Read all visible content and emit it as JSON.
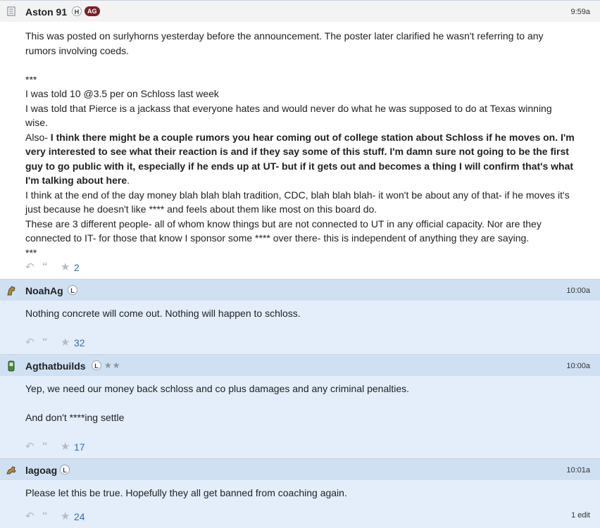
{
  "posts": [
    {
      "username": "Aston 91",
      "avatar_icon": "document-icon",
      "badges": [
        "H",
        "AG"
      ],
      "stars": "",
      "time": "9:59a",
      "lines": [
        "This was posted on surlyhorns yesterday before the announcement. The poster later clarified he wasn't referring to any",
        "rumors involving coeds.",
        "***",
        "I was told 10 @3.5 per on Schloss last week",
        "I was told that Pierce is a jackass that everyone hates and would never do what he was supposed to do at Texas winning wise.",
        "Also- ",
        "I think there might be a couple rumors you hear coming out of college station about Schloss if he moves on. I'm very interested to see what their reaction is and if they say some of this stuff. I'm damn sure not going to be the first guy to go public with it, especially if he ends up at UT- but if it gets out and becomes a thing I will confirm that's what I'm talking about here",
        ".",
        "I think at the end of the day money blah blah blah tradition, CDC, blah blah blah- it won't be about any of that- if he moves it's just because he doesn't like **** and feels about them like most on this board do.",
        "These are 3 different people- all of whom know things but are not connected to UT in any official capacity. Nor are they connected to IT- for those that know I sponsor some **** over there- this is independent of anything they are saying.",
        "***"
      ],
      "star_count": "2",
      "edit": ""
    },
    {
      "username": "NoahAg",
      "avatar_icon": "horse-head-icon",
      "badges": [
        "L"
      ],
      "stars": "",
      "time": "10:00a",
      "text1": "Nothing concrete will come out. Nothing will happen to schloss.",
      "star_count": "32",
      "edit": ""
    },
    {
      "username": "Agthatbuilds",
      "avatar_icon": "phone-icon",
      "badges": [
        "L"
      ],
      "stars": "★★",
      "time": "10:00a",
      "text1": "Yep, we need our money back schloss and co plus damages and any criminal penalties.",
      "text2": "And don't ****ing settle",
      "star_count": "17",
      "edit": ""
    },
    {
      "username": "lagoag",
      "avatar_icon": "horse-icon",
      "badges": [
        "L"
      ],
      "stars": "",
      "time": "10:01a",
      "text1": "Please let this be true. Hopefully they all get banned from coaching again.",
      "star_count": "24",
      "edit": "1 edit"
    }
  ],
  "colors": {
    "ag_badge": "#7a1f2b",
    "link_count": "#3a6ea5",
    "blue_bg": "#e3eefa",
    "blue_head": "#cfe0f3"
  }
}
